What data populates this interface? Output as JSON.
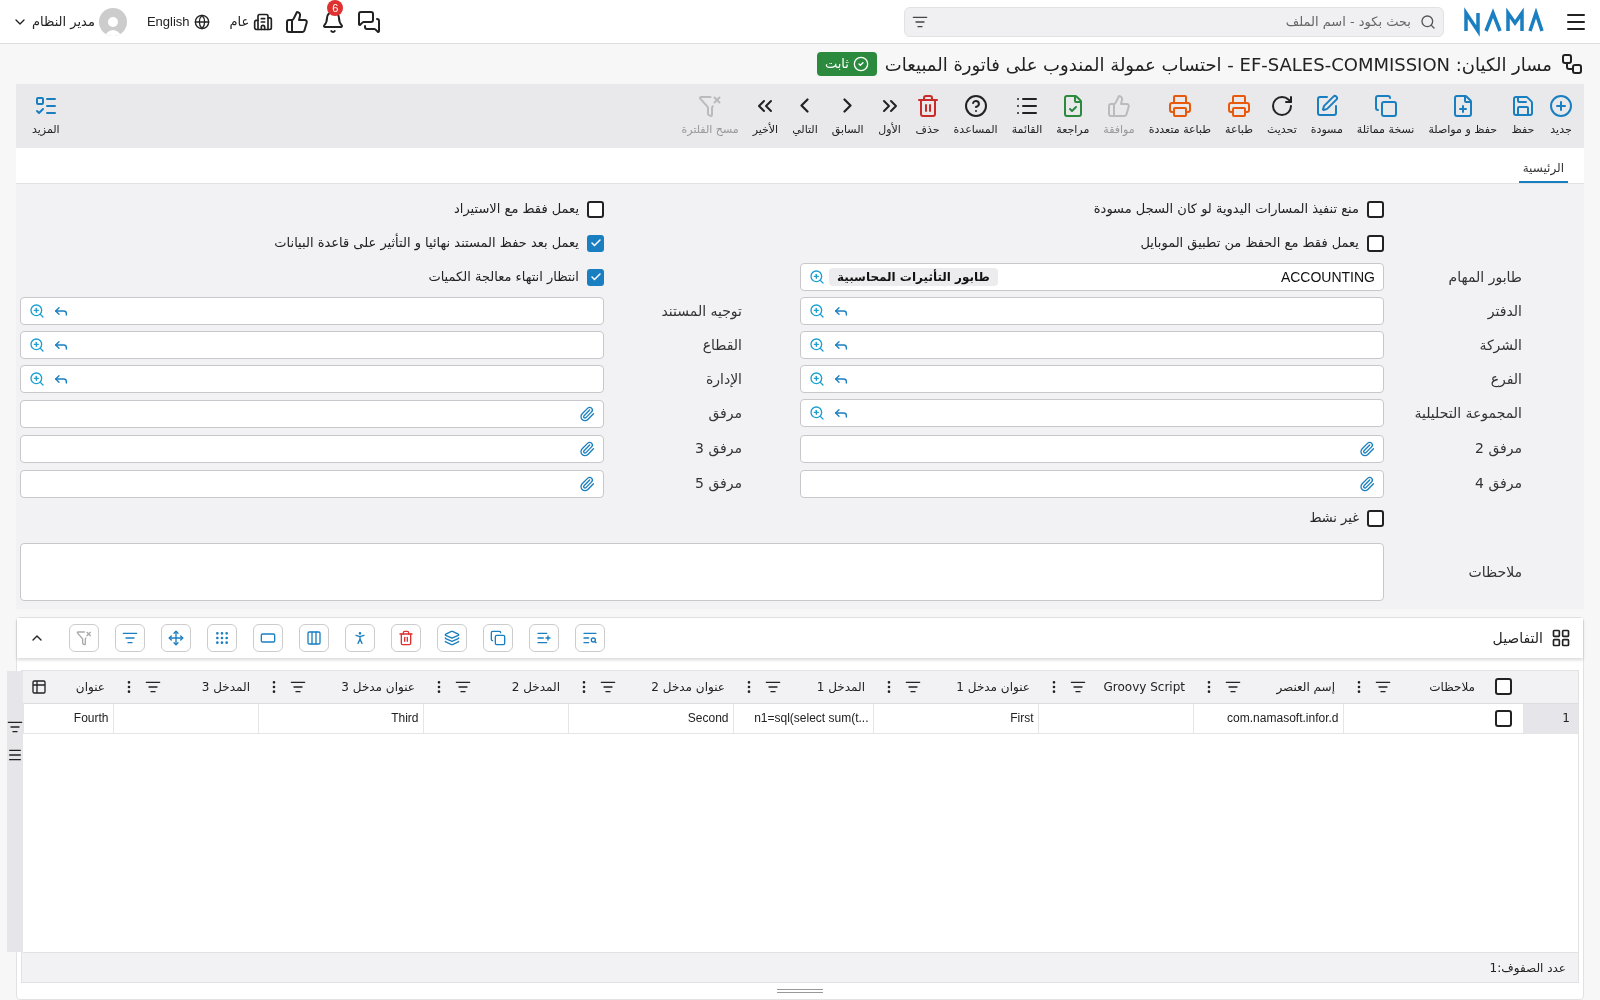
{
  "top_bar": {
    "search": {
      "placeholder": "بحث بكود - اسم الملف"
    },
    "notifications": "6",
    "company": "عام",
    "language": "English",
    "user": "مدير النظام"
  },
  "page_title": "مسار الكيان: EF-SALES-COMMISSION - احتساب عمولة المندوب على فاتورة المبيعات",
  "status_badge": "ثابت",
  "toolbar": [
    {
      "label": "جديد",
      "disabled": false
    },
    {
      "label": "حفظ",
      "disabled": false
    },
    {
      "label": "حفظ و مواصلة",
      "disabled": false
    },
    {
      "label": "نسخة مماثلة",
      "disabled": false
    },
    {
      "label": "مسودة",
      "disabled": false
    },
    {
      "label": "تحديث",
      "disabled": false
    },
    {
      "label": "طباعة",
      "disabled": false
    },
    {
      "label": "طباعة متعددة",
      "disabled": false
    },
    {
      "label": "موافقة",
      "disabled": true
    },
    {
      "label": "مراجعة",
      "disabled": false
    },
    {
      "label": "القائمة",
      "disabled": false
    },
    {
      "label": "المساعدة",
      "disabled": false
    },
    {
      "label": "حذف",
      "disabled": false
    },
    {
      "label": "الأول",
      "disabled": false
    },
    {
      "label": "السابق",
      "disabled": false
    },
    {
      "label": "التالي",
      "disabled": false
    },
    {
      "label": "الأخير",
      "disabled": false
    },
    {
      "label": "مسح الفلترة",
      "disabled": true
    }
  ],
  "toolbar_more": "المزيد",
  "tabs": [
    {
      "label": "الرئيسية",
      "selected": true
    }
  ],
  "form_rows": [
    {
      "right": {
        "kind": "checkbox",
        "label": "منع تنفيذ المسارات اليدوية لو كان السجل مسودة",
        "checked": false
      },
      "left": {
        "kind": "checkbox",
        "label": "يعمل فقط مع الاستيراد",
        "checked": false
      }
    },
    {
      "right": {
        "kind": "checkbox",
        "label": "يعمل فقط مع الحفظ من تطبيق الموبايل",
        "checked": false
      },
      "left": {
        "kind": "checkbox",
        "label": "يعمل بعد حفظ المستند نهائيا و التأثير على قاعدة البيانات",
        "checked": true
      }
    },
    {
      "right": {
        "kind": "queue",
        "label": "طابور المهام",
        "value": "ACCOUNTING",
        "chip": "طابور التأثيرات المحاسبية"
      },
      "left": {
        "kind": "checkbox",
        "label": "انتظار انتهاء معالجة الكميات",
        "checked": true
      }
    },
    {
      "right": {
        "kind": "lookup",
        "label": "الدفتر"
      },
      "left": {
        "kind": "lookup",
        "label": "توجيه المستند"
      }
    },
    {
      "right": {
        "kind": "lookup",
        "label": "الشركة"
      },
      "left": {
        "kind": "lookup",
        "label": "القطاع"
      }
    },
    {
      "right": {
        "kind": "lookup",
        "label": "الفرع"
      },
      "left": {
        "kind": "lookup",
        "label": "الإدارة"
      }
    },
    {
      "right": {
        "kind": "lookup",
        "label": "المجموعة التحليلية"
      },
      "left": {
        "kind": "attachment",
        "label": "مرفق"
      }
    },
    {
      "right": {
        "kind": "attachment",
        "label": "مرفق 2"
      },
      "left": {
        "kind": "attachment",
        "label": "مرفق 3"
      }
    },
    {
      "right": {
        "kind": "attachment",
        "label": "مرفق 4"
      },
      "left": {
        "kind": "attachment",
        "label": "مرفق 5"
      }
    },
    {
      "right": {
        "kind": "checkbox",
        "label": "غير نشط",
        "checked": false
      }
    }
  ],
  "notes": {
    "label": "ملاحظات"
  },
  "details": {
    "title": "التفاصيل",
    "all_selected": false,
    "columns": [
      "ملاحظات",
      "إسم العنصر",
      "Groovy Script",
      "عنوان مدخل 1",
      "المدخل 1",
      "عنوان مدخل 2",
      "المدخل 2",
      "عنوان مدخل 3",
      "المدخل 3",
      "عنوان"
    ],
    "rows": [
      {
        "number": "1",
        "selected": false,
        "cells": [
          "",
          "com.namasoft.infor.d",
          "",
          "First",
          "n1=sql(select sum(t...",
          "Second",
          "",
          "Third",
          "",
          "Fourth"
        ]
      }
    ],
    "row_count": "عدد الصفوف:1"
  }
}
